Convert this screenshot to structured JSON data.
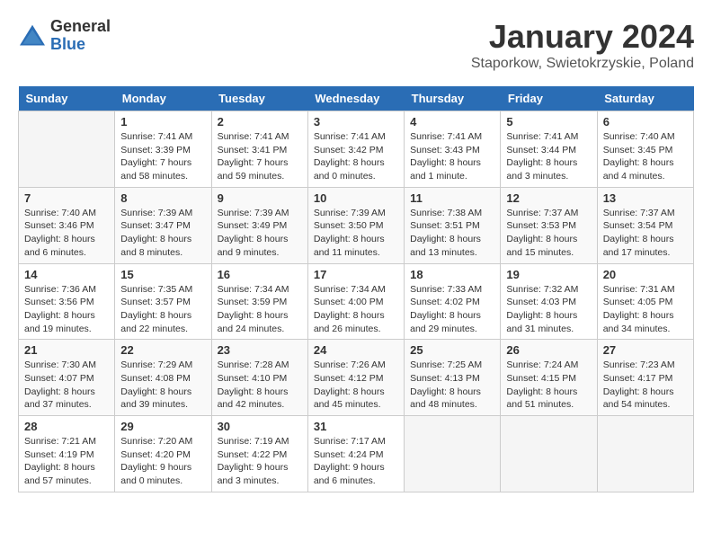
{
  "header": {
    "logo_general": "General",
    "logo_blue": "Blue",
    "title": "January 2024",
    "location": "Staporkow, Swietokrzyskie, Poland"
  },
  "days_of_week": [
    "Sunday",
    "Monday",
    "Tuesday",
    "Wednesday",
    "Thursday",
    "Friday",
    "Saturday"
  ],
  "weeks": [
    [
      {
        "day": "",
        "content": ""
      },
      {
        "day": "1",
        "content": "Sunrise: 7:41 AM\nSunset: 3:39 PM\nDaylight: 7 hours\nand 58 minutes."
      },
      {
        "day": "2",
        "content": "Sunrise: 7:41 AM\nSunset: 3:41 PM\nDaylight: 7 hours\nand 59 minutes."
      },
      {
        "day": "3",
        "content": "Sunrise: 7:41 AM\nSunset: 3:42 PM\nDaylight: 8 hours\nand 0 minutes."
      },
      {
        "day": "4",
        "content": "Sunrise: 7:41 AM\nSunset: 3:43 PM\nDaylight: 8 hours\nand 1 minute."
      },
      {
        "day": "5",
        "content": "Sunrise: 7:41 AM\nSunset: 3:44 PM\nDaylight: 8 hours\nand 3 minutes."
      },
      {
        "day": "6",
        "content": "Sunrise: 7:40 AM\nSunset: 3:45 PM\nDaylight: 8 hours\nand 4 minutes."
      }
    ],
    [
      {
        "day": "7",
        "content": "Sunrise: 7:40 AM\nSunset: 3:46 PM\nDaylight: 8 hours\nand 6 minutes."
      },
      {
        "day": "8",
        "content": "Sunrise: 7:39 AM\nSunset: 3:47 PM\nDaylight: 8 hours\nand 8 minutes."
      },
      {
        "day": "9",
        "content": "Sunrise: 7:39 AM\nSunset: 3:49 PM\nDaylight: 8 hours\nand 9 minutes."
      },
      {
        "day": "10",
        "content": "Sunrise: 7:39 AM\nSunset: 3:50 PM\nDaylight: 8 hours\nand 11 minutes."
      },
      {
        "day": "11",
        "content": "Sunrise: 7:38 AM\nSunset: 3:51 PM\nDaylight: 8 hours\nand 13 minutes."
      },
      {
        "day": "12",
        "content": "Sunrise: 7:37 AM\nSunset: 3:53 PM\nDaylight: 8 hours\nand 15 minutes."
      },
      {
        "day": "13",
        "content": "Sunrise: 7:37 AM\nSunset: 3:54 PM\nDaylight: 8 hours\nand 17 minutes."
      }
    ],
    [
      {
        "day": "14",
        "content": "Sunrise: 7:36 AM\nSunset: 3:56 PM\nDaylight: 8 hours\nand 19 minutes."
      },
      {
        "day": "15",
        "content": "Sunrise: 7:35 AM\nSunset: 3:57 PM\nDaylight: 8 hours\nand 22 minutes."
      },
      {
        "day": "16",
        "content": "Sunrise: 7:34 AM\nSunset: 3:59 PM\nDaylight: 8 hours\nand 24 minutes."
      },
      {
        "day": "17",
        "content": "Sunrise: 7:34 AM\nSunset: 4:00 PM\nDaylight: 8 hours\nand 26 minutes."
      },
      {
        "day": "18",
        "content": "Sunrise: 7:33 AM\nSunset: 4:02 PM\nDaylight: 8 hours\nand 29 minutes."
      },
      {
        "day": "19",
        "content": "Sunrise: 7:32 AM\nSunset: 4:03 PM\nDaylight: 8 hours\nand 31 minutes."
      },
      {
        "day": "20",
        "content": "Sunrise: 7:31 AM\nSunset: 4:05 PM\nDaylight: 8 hours\nand 34 minutes."
      }
    ],
    [
      {
        "day": "21",
        "content": "Sunrise: 7:30 AM\nSunset: 4:07 PM\nDaylight: 8 hours\nand 37 minutes."
      },
      {
        "day": "22",
        "content": "Sunrise: 7:29 AM\nSunset: 4:08 PM\nDaylight: 8 hours\nand 39 minutes."
      },
      {
        "day": "23",
        "content": "Sunrise: 7:28 AM\nSunset: 4:10 PM\nDaylight: 8 hours\nand 42 minutes."
      },
      {
        "day": "24",
        "content": "Sunrise: 7:26 AM\nSunset: 4:12 PM\nDaylight: 8 hours\nand 45 minutes."
      },
      {
        "day": "25",
        "content": "Sunrise: 7:25 AM\nSunset: 4:13 PM\nDaylight: 8 hours\nand 48 minutes."
      },
      {
        "day": "26",
        "content": "Sunrise: 7:24 AM\nSunset: 4:15 PM\nDaylight: 8 hours\nand 51 minutes."
      },
      {
        "day": "27",
        "content": "Sunrise: 7:23 AM\nSunset: 4:17 PM\nDaylight: 8 hours\nand 54 minutes."
      }
    ],
    [
      {
        "day": "28",
        "content": "Sunrise: 7:21 AM\nSunset: 4:19 PM\nDaylight: 8 hours\nand 57 minutes."
      },
      {
        "day": "29",
        "content": "Sunrise: 7:20 AM\nSunset: 4:20 PM\nDaylight: 9 hours\nand 0 minutes."
      },
      {
        "day": "30",
        "content": "Sunrise: 7:19 AM\nSunset: 4:22 PM\nDaylight: 9 hours\nand 3 minutes."
      },
      {
        "day": "31",
        "content": "Sunrise: 7:17 AM\nSunset: 4:24 PM\nDaylight: 9 hours\nand 6 minutes."
      },
      {
        "day": "",
        "content": ""
      },
      {
        "day": "",
        "content": ""
      },
      {
        "day": "",
        "content": ""
      }
    ]
  ]
}
